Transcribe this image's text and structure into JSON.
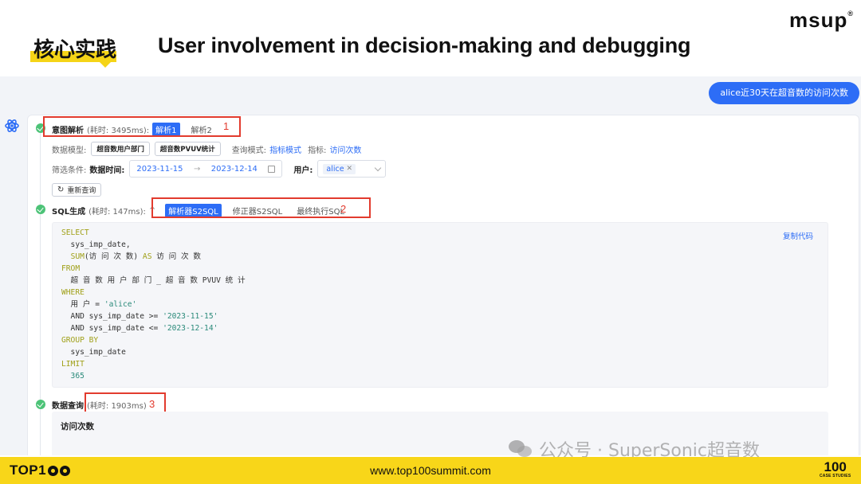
{
  "slide": {
    "badge": "核心实践",
    "title": "User involvement in decision-making and debugging",
    "brand": "msup",
    "brand_mark": "®"
  },
  "chat": {
    "user_message": "alice近30天在超音数的访问次数"
  },
  "intent": {
    "title": "意图解析",
    "time": "(耗时: 3495ms):",
    "tab_active": "解析1",
    "tab_other": "解析2",
    "annotation": "1",
    "model_label": "数据模型:",
    "models": [
      "超音数用户部门",
      "超音数PVUV统计"
    ],
    "query_mode_label": "查询模式:",
    "query_mode": "指标模式",
    "metric_label": "指标:",
    "metric": "访问次数",
    "filter_label": "筛选条件:",
    "date_label": "数据时间:",
    "date_start": "2023-11-15",
    "date_arrow": "→",
    "date_end": "2023-12-14",
    "user_label": "用户:",
    "user_tag": "alice",
    "requery_button": "重新查询"
  },
  "sql": {
    "title": "SQL生成",
    "time": "(耗时: 147ms):",
    "caret": "^",
    "tab_active": "解析器S2SQL",
    "tab_correct": "修正器S2SQL",
    "tab_final": "最终执行SQL",
    "annotation": "2",
    "copy_label": "复制代码",
    "lines": {
      "l1": "SELECT",
      "l2": "  sys_imp_date,",
      "l3_fn": "SUM",
      "l3_rest": "(访 问 次 数) ",
      "l3_as": "AS",
      "l3_alias": " 访 问 次 数",
      "l4": "FROM",
      "l5": "  超 音 数 用 户 部 门 _ 超 音 数 PVUV 统 计",
      "l6": "WHERE",
      "l7_a": "  用 户 = ",
      "l7_s": "'alice'",
      "l8_a": "  AND sys_imp_date >= ",
      "l8_s": "'2023-11-15'",
      "l9_a": "  AND sys_imp_date <= ",
      "l9_s": "'2023-12-14'",
      "l10": "GROUP BY",
      "l11": "  sys_imp_date",
      "l12": "LIMIT",
      "l13": "  365"
    }
  },
  "data_query": {
    "title": "数据查询",
    "time": "(耗时: 1903ms)",
    "annotation": "3",
    "result_title": "访问次数"
  },
  "watermark": "公众号 · SuperSonic超音数",
  "footer": {
    "left_logo": "TOP1",
    "url": "www.top100summit.com",
    "right_logo": "100",
    "right_logo_sub": "CASE STUDIES"
  },
  "colors": {
    "accent": "#2d6df6",
    "annotation_red": "#e23b2e",
    "footer_yellow": "#f8d619",
    "step_green": "#4cc377"
  }
}
